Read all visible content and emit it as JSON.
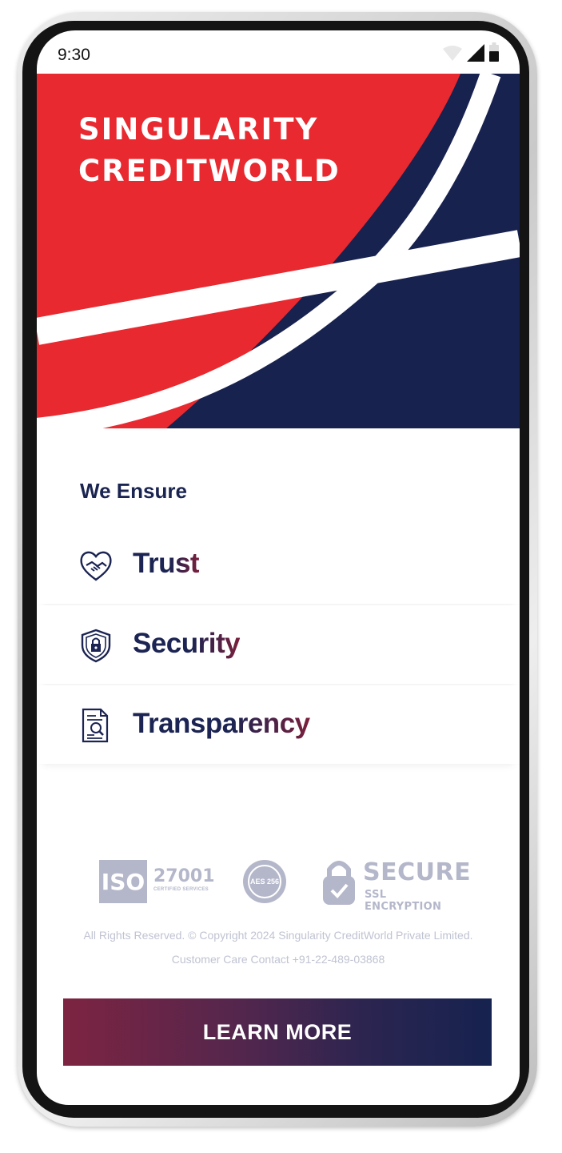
{
  "status_bar": {
    "time": "9:30",
    "icons": [
      "wifi-icon",
      "signal-icon",
      "battery-icon"
    ]
  },
  "hero": {
    "brand_line1": "SINGULARITY",
    "brand_line2": "CREDITWORLD",
    "colors": {
      "red": "#e8292f",
      "navy": "#18224f",
      "stripe": "#ffffff"
    }
  },
  "ensure": {
    "title": "We Ensure",
    "items": [
      {
        "label": "Trust",
        "icon": "handshake-heart-icon"
      },
      {
        "label": "Security",
        "icon": "shield-lock-icon"
      },
      {
        "label": "Transparency",
        "icon": "document-magnifier-icon"
      }
    ]
  },
  "badges": {
    "iso_mark": "ISO",
    "iso_number": "27001",
    "iso_subtitle": "CERTIFIED SERVICES",
    "aes_label": "AES 256",
    "secure_title": "SECURE",
    "secure_subtitle": "SSL ENCRYPTION"
  },
  "footer": {
    "copyright": "All Rights Reserved. © Copyright 2024 Singularity CreditWorld Private Limited.",
    "care": "Customer Care Contact +91-22-489-03868"
  },
  "cta": {
    "label": "LEARN MORE"
  },
  "theme": {
    "navy": "#1b2452",
    "maroon": "#7d2441",
    "badge_gray": "#b4b7ca"
  }
}
